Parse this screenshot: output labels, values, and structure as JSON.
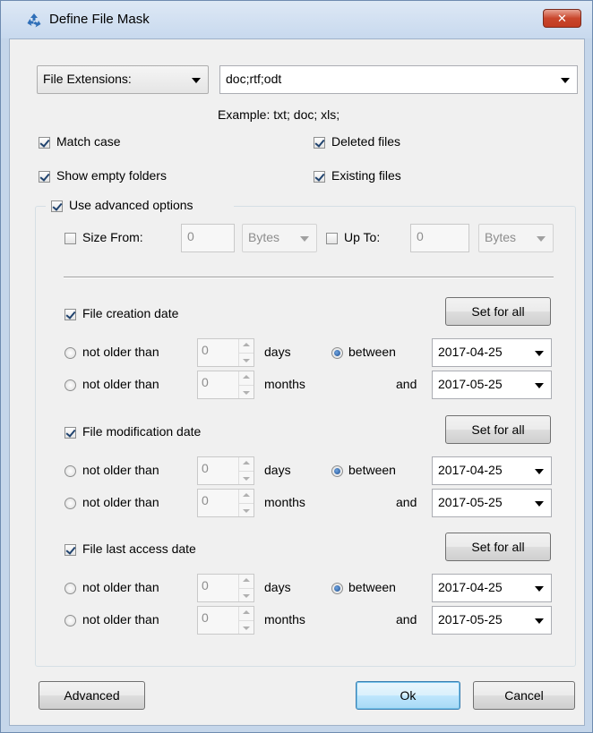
{
  "window": {
    "title": "Define File Mask",
    "close_glyph": "✕"
  },
  "mask": {
    "type_label": "File Extensions:",
    "value": "doc;rtf;odt",
    "example": "Example: txt; doc; xls;"
  },
  "options": {
    "match_case": "Match case",
    "deleted_files": "Deleted files",
    "show_empty_folders": "Show empty folders",
    "existing_files": "Existing files",
    "use_advanced": "Use advanced options"
  },
  "size": {
    "from_label": "Size From:",
    "from_value": "0",
    "from_unit": "Bytes",
    "to_label": "Up To:",
    "to_value": "0",
    "to_unit": "Bytes"
  },
  "date_sections": [
    {
      "label": "File creation date",
      "set_all": "Set for all",
      "not_older_label": "not older than",
      "days_value": "0",
      "days_label": "days",
      "months_value": "0",
      "months_label": "months",
      "between_label": "between",
      "and_label": "and",
      "from_date": "2017-04-25",
      "to_date": "2017-05-25"
    },
    {
      "label": "File modification date",
      "set_all": "Set for all",
      "not_older_label": "not older than",
      "days_value": "0",
      "days_label": "days",
      "months_value": "0",
      "months_label": "months",
      "between_label": "between",
      "and_label": "and",
      "from_date": "2017-04-25",
      "to_date": "2017-05-25"
    },
    {
      "label": "File last access date",
      "set_all": "Set for all",
      "not_older_label": "not older than",
      "days_value": "0",
      "days_label": "days",
      "months_value": "0",
      "months_label": "months",
      "between_label": "between",
      "and_label": "and",
      "from_date": "2017-04-25",
      "to_date": "2017-05-25"
    }
  ],
  "buttons": {
    "advanced": "Advanced",
    "ok": "Ok",
    "cancel": "Cancel"
  },
  "colors": {
    "title_bar": "#c8d9ee",
    "close": "#c9462c",
    "dialog_bg": "#f0f0f0",
    "check": "#20436e"
  },
  "icons": {
    "app": "recycle-icon",
    "close": "close-icon"
  }
}
